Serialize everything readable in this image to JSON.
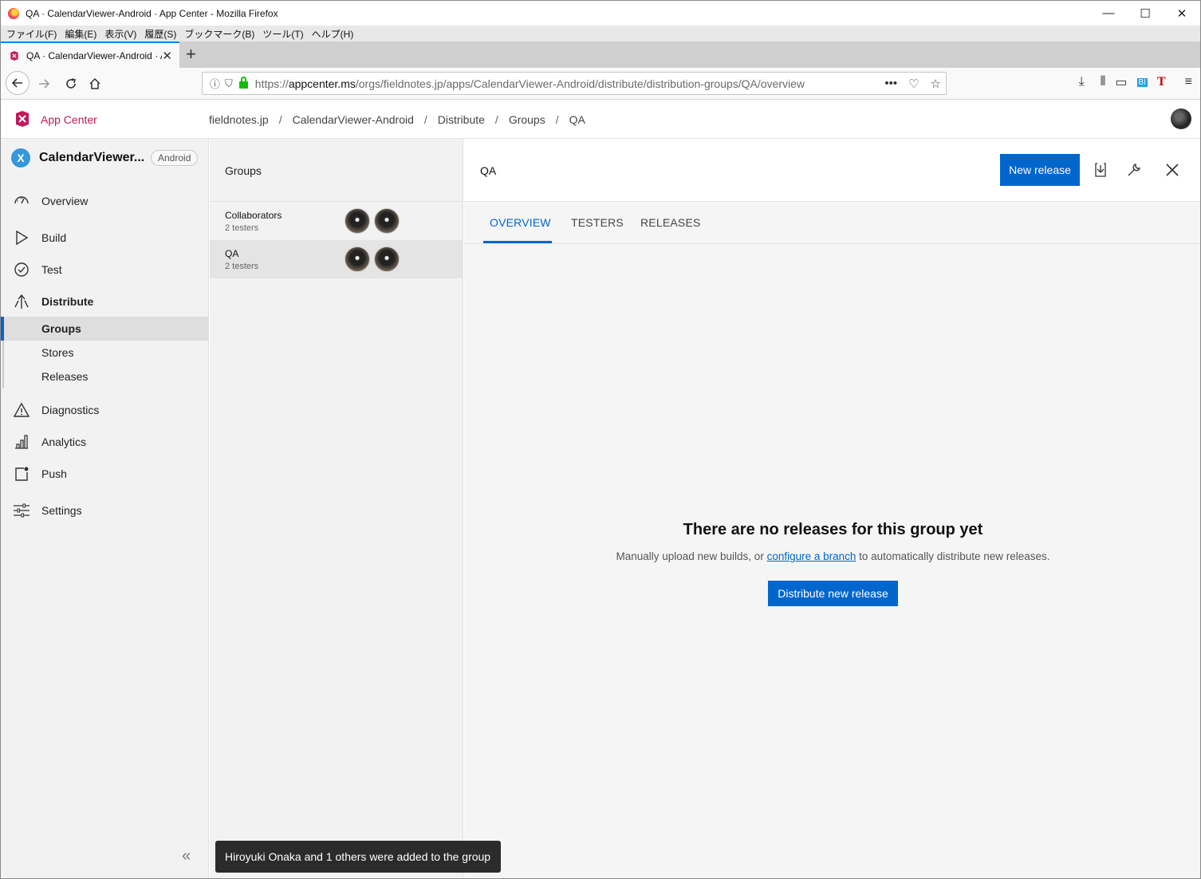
{
  "window": {
    "title": "QA · CalendarViewer-Android · App Center - Mozilla Firefox",
    "minimize": "—",
    "maximize": "☐",
    "close": "✕"
  },
  "menubar": [
    "ファイル(F)",
    "編集(E)",
    "表示(V)",
    "履歴(S)",
    "ブックマーク(B)",
    "ツール(T)",
    "ヘルプ(H)"
  ],
  "browser": {
    "tab_title": "QA · CalendarViewer-Android · App Center",
    "url_prefix": "https://",
    "url_domain": "appcenter.ms",
    "url_path": "/orgs/fieldnotes.jp/apps/CalendarViewer-Android/distribute/distribution-groups/QA/overview"
  },
  "app_header": {
    "brand": "App Center",
    "breadcrumbs": [
      "fieldnotes.jp",
      "CalendarViewer-Android",
      "Distribute",
      "Groups",
      "QA"
    ],
    "separator": "/"
  },
  "sidebar": {
    "app_name": "CalendarViewer...",
    "platform": "Android",
    "items": [
      {
        "label": "Overview",
        "icon": "gauge-icon"
      },
      {
        "label": "Build",
        "icon": "play-icon"
      },
      {
        "label": "Test",
        "icon": "check-circle-icon"
      },
      {
        "label": "Distribute",
        "icon": "distribute-icon"
      },
      {
        "label": "Diagnostics",
        "icon": "warning-icon"
      },
      {
        "label": "Analytics",
        "icon": "bar-chart-icon"
      },
      {
        "label": "Push",
        "icon": "push-icon"
      },
      {
        "label": "Settings",
        "icon": "sliders-icon"
      }
    ],
    "distribute_sub": [
      "Groups",
      "Stores",
      "Releases"
    ]
  },
  "groups_panel": {
    "title": "Groups",
    "groups": [
      {
        "name": "Collaborators",
        "count": "2 testers"
      },
      {
        "name": "QA",
        "count": "2 testers"
      }
    ]
  },
  "main": {
    "title": "QA",
    "new_release": "New release",
    "tabs": [
      "OVERVIEW",
      "TESTERS",
      "RELEASES"
    ],
    "empty_title": "There are no releases for this group yet",
    "empty_desc_before": "Manually upload new builds, or ",
    "empty_desc_link": "configure a branch",
    "empty_desc_after": " to automatically distribute new releases.",
    "distribute_button": "Distribute new release"
  },
  "toast": "Hiroyuki Onaka and 1 others were added to the group",
  "colors": {
    "primary": "#0066cc",
    "brand": "#c2185b"
  }
}
